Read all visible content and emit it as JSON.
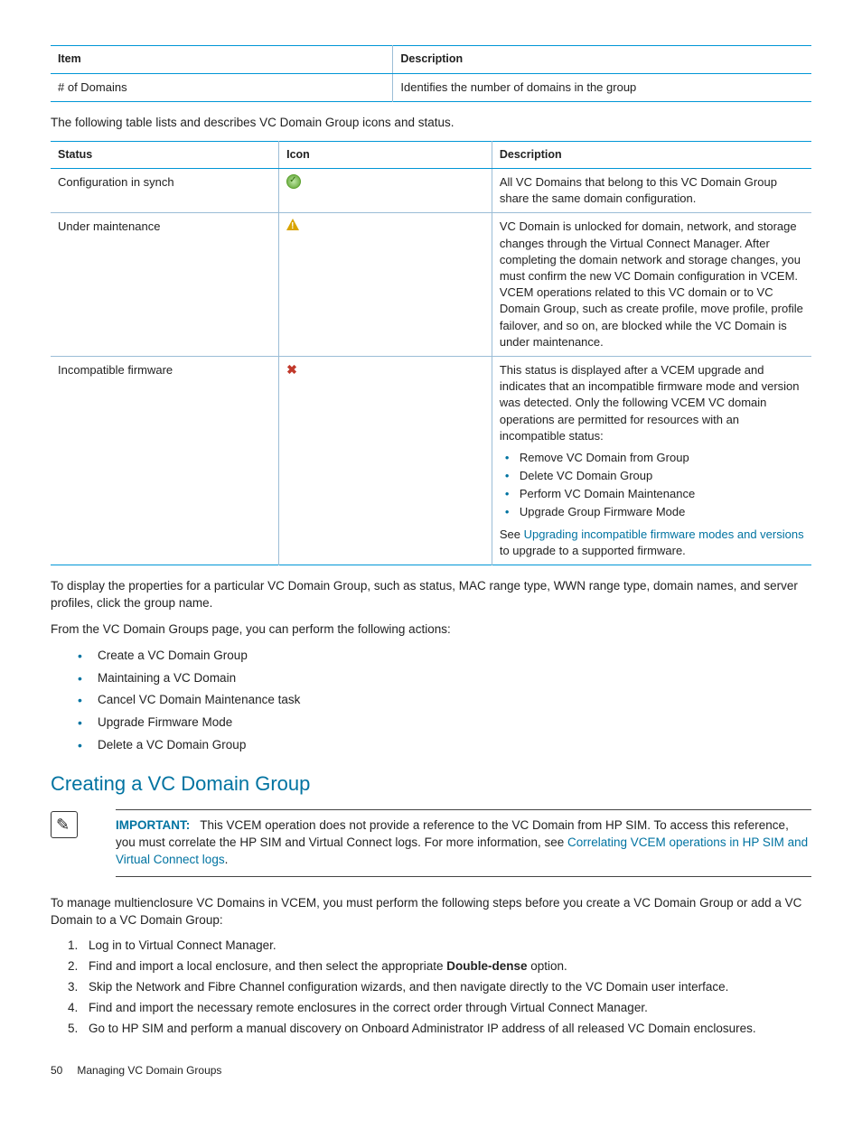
{
  "table1": {
    "head": {
      "c1": "Item",
      "c2": "Description"
    },
    "row": {
      "c1": "# of Domains",
      "c2": "Identifies the number of domains in the group"
    }
  },
  "intro1": "The following table lists and describes VC Domain Group icons and status.",
  "table2": {
    "head": {
      "c1": "Status",
      "c2": "Icon",
      "c3": "Description"
    },
    "rows": [
      {
        "status": "Configuration in synch",
        "iconname": "sync-ok-icon",
        "desc": "All VC Domains that belong to this VC Domain Group share the same domain configuration."
      },
      {
        "status": "Under maintenance",
        "iconname": "warning-icon",
        "desc": "VC Domain is unlocked for domain, network, and storage changes through the Virtual Connect Manager. After completing the domain network and storage changes, you must confirm the new VC Domain configuration in VCEM. VCEM operations related to this VC domain or to VC Domain Group, such as create profile, move profile, profile failover, and so on, are blocked while the VC Domain is under maintenance."
      },
      {
        "status": "Incompatible firmware",
        "iconname": "error-icon",
        "desc_pre": "This status is displayed after a VCEM upgrade and indicates that an incompatible firmware mode and version was detected. Only the following VCEM VC domain operations are permitted for resources with an incompatible status:",
        "bullets": [
          "Remove VC Domain from Group",
          "Delete VC Domain Group",
          "Perform VC Domain Maintenance",
          "Upgrade Group Firmware Mode"
        ],
        "desc_post_pre": "See ",
        "desc_post_link": "Upgrading incompatible firmware modes and versions",
        "desc_post_suf": " to upgrade to a supported firmware."
      }
    ]
  },
  "para2": "To display the properties for a particular VC Domain Group, such as status, MAC range type, WWN range type, domain names, and server profiles, click the group name.",
  "para3": "From the VC Domain Groups page, you can perform the following actions:",
  "actions": [
    "Create a VC Domain Group",
    "Maintaining a VC Domain",
    "Cancel VC Domain Maintenance task",
    "Upgrade Firmware Mode",
    "Delete a VC Domain Group"
  ],
  "section_title": "Creating a VC Domain Group",
  "important": {
    "label": "IMPORTANT:",
    "text1": "This VCEM operation does not provide a reference to the VC Domain from HP SIM. To access this reference, you must correlate the HP SIM and Virtual Connect logs. For more information, see ",
    "link": "Correlating VCEM operations in HP SIM and Virtual Connect logs",
    "text2": "."
  },
  "para4": "To manage multienclosure VC Domains in VCEM, you must perform the following steps before you create a VC Domain Group or add a VC Domain to a VC Domain Group:",
  "steps": [
    "Log in to Virtual Connect Manager.",
    {
      "pre": "Find and import a local enclosure, and then select the appropriate ",
      "bold": "Double-dense",
      "post": " option."
    },
    "Skip the Network and Fibre Channel configuration wizards, and then navigate directly to the VC Domain user interface.",
    "Find and import the necessary remote enclosures in the correct order through Virtual Connect Manager.",
    "Go to HP SIM and perform a manual discovery on Onboard Administrator IP address of all released VC Domain enclosures."
  ],
  "footer": {
    "page": "50",
    "title": "Managing VC Domain Groups"
  }
}
